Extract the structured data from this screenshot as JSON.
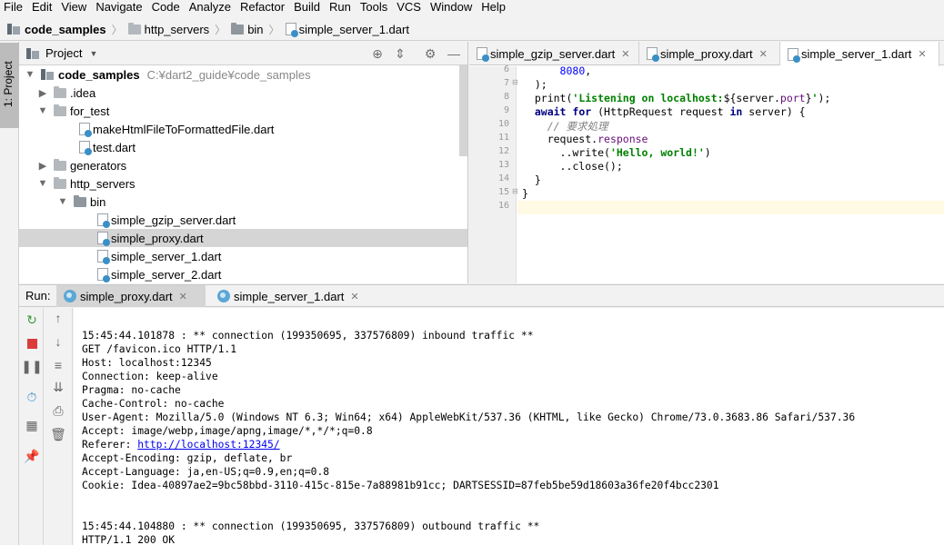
{
  "menu": [
    "File",
    "Edit",
    "View",
    "Navigate",
    "Code",
    "Analyze",
    "Refactor",
    "Build",
    "Run",
    "Tools",
    "VCS",
    "Window",
    "Help"
  ],
  "breadcrumb": [
    "code_samples",
    "http_servers",
    "bin",
    "simple_server_1.dart"
  ],
  "sidebar": {
    "project_tab": "1: Project"
  },
  "project_panel": {
    "title": "Project",
    "tree": [
      {
        "label": "code_samples",
        "path": "C:¥dart2_guide¥code_samples",
        "arrow": "▼",
        "kind": "project"
      },
      {
        "label": ".idea",
        "arrow": "▶",
        "kind": "folder"
      },
      {
        "label": "for_test",
        "arrow": "▼",
        "kind": "folder"
      },
      {
        "label": "makeHtmlFileToFormattedFile.dart",
        "kind": "file"
      },
      {
        "label": "test.dart",
        "kind": "file"
      },
      {
        "label": "generators",
        "arrow": "▶",
        "kind": "folder"
      },
      {
        "label": "http_servers",
        "arrow": "▼",
        "kind": "folder"
      },
      {
        "label": "bin",
        "arrow": "▼",
        "kind": "folder"
      },
      {
        "label": "simple_gzip_server.dart",
        "kind": "file"
      },
      {
        "label": "simple_proxy.dart",
        "kind": "file",
        "selected": true
      },
      {
        "label": "simple_server_1.dart",
        "kind": "file"
      },
      {
        "label": "simple_server_2.dart",
        "kind": "file"
      }
    ]
  },
  "editor": {
    "tabs": [
      "simple_gzip_server.dart",
      "simple_proxy.dart",
      "simple_server_1.dart"
    ],
    "active_tab": 2,
    "line_numbers": [
      "6",
      "7",
      "8",
      "9",
      "10",
      "11",
      "12",
      "13",
      "14",
      "15",
      "16"
    ]
  },
  "run": {
    "label": "Run:",
    "tabs": [
      "simple_proxy.dart",
      "simple_server_1.dart"
    ],
    "active_tab": 0
  },
  "console": [
    "15:45:44.101878 : ** connection (199350695, 337576809) inbound traffic **",
    "GET /favicon.ico HTTP/1.1",
    "Host: localhost:12345",
    "Connection: keep-alive",
    "Pragma: no-cache",
    "Cache-Control: no-cache",
    "User-Agent: Mozilla/5.0 (Windows NT 6.3; Win64; x64) AppleWebKit/537.36 (KHTML, like Gecko) Chrome/73.0.3683.86 Safari/537.36",
    "Accept: image/webp,image/apng,image/*,*/*;q=0.8",
    "Referer: ",
    "Accept-Encoding: gzip, deflate, br",
    "Accept-Language: ja,en-US;q=0.9,en;q=0.8",
    "Cookie: Idea-40897ae2=9bc58bbd-3110-415c-815e-7a88981b91cc; DARTSESSID=87feb5be59d18603a36fe20f4bcc2301",
    "",
    "",
    "15:45:44.104880 : ** connection (199350695, 337576809) outbound traffic **",
    "HTTP/1.1 200 OK"
  ],
  "console_link": "http://localhost:12345/",
  "colors": {
    "selection": "#d5d5d5",
    "keyword": "#000080",
    "string": "#008000",
    "number": "#0000ff",
    "comment": "#808080",
    "field": "#660e7a",
    "link": "#0000ee"
  }
}
